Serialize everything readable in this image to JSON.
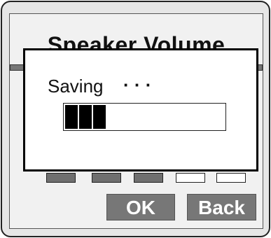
{
  "screen": {
    "title": "Speaker Volume"
  },
  "volume": {
    "level_segments": 5,
    "level_on": 3
  },
  "softkeys": {
    "ok_label": "OK",
    "back_label": "Back"
  },
  "dialog": {
    "message": "Saving",
    "dots": "· · ·",
    "progress_blocks_filled": 3,
    "progress_fraction": 0.28
  },
  "colors": {
    "softkey_bg": "#777777",
    "progress_fill": "#000000",
    "dialog_border": "#000000"
  }
}
